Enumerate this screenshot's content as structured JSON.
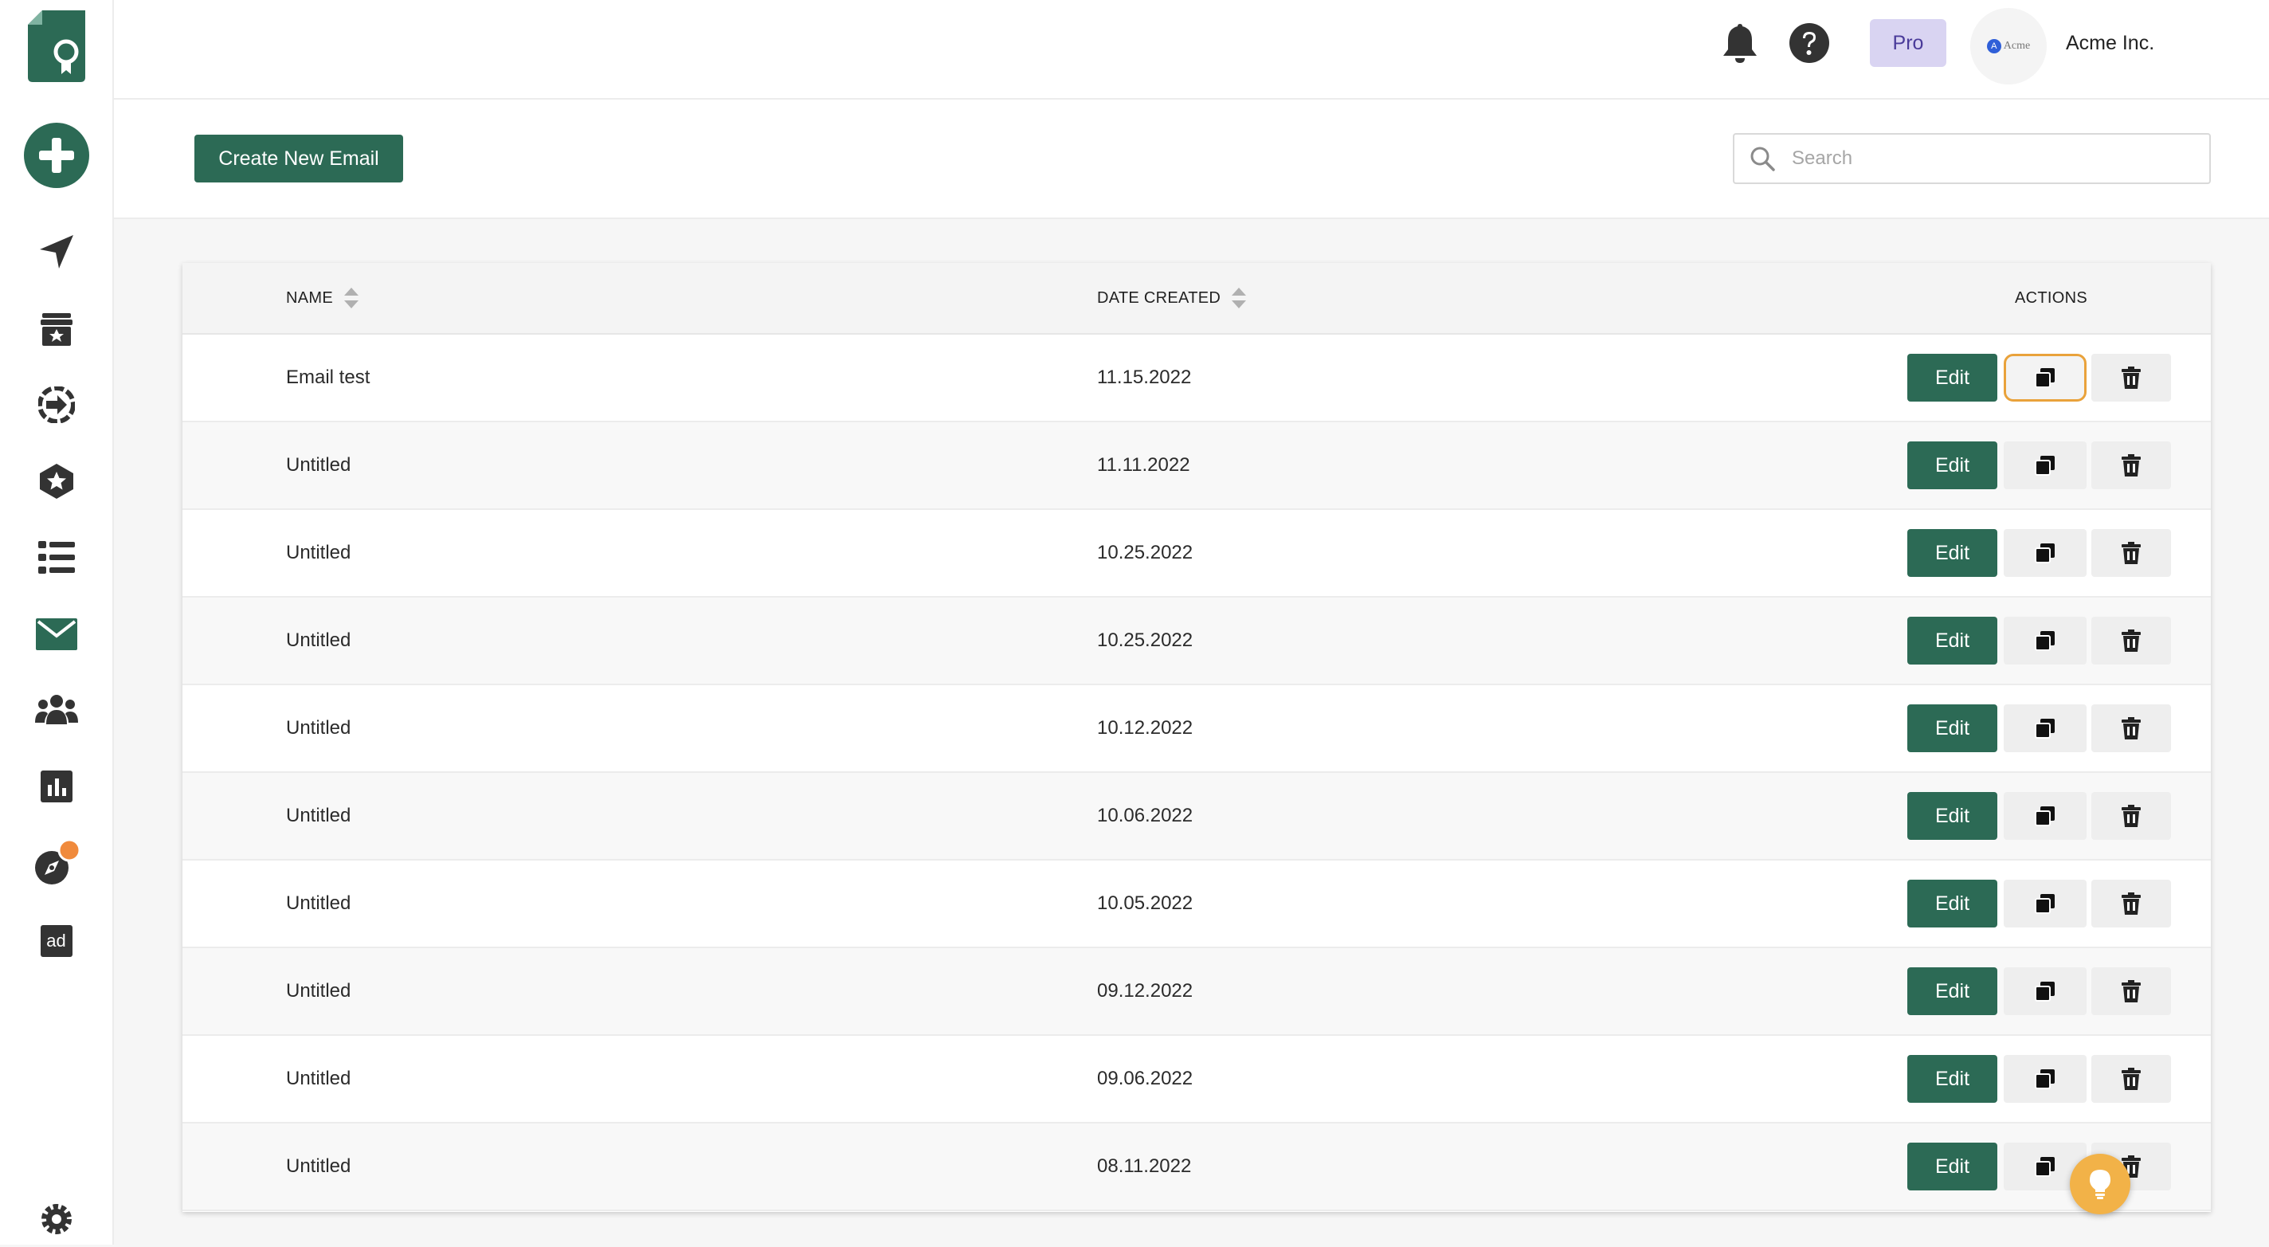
{
  "header": {
    "plan_badge": "Pro",
    "org_logo_text": "Acme",
    "org_logo_initial": "A",
    "org_name": "Acme Inc."
  },
  "sidebar": {
    "items": [
      {
        "name": "create",
        "icon": "plus-circle-icon"
      },
      {
        "name": "campaigns",
        "icon": "send-icon"
      },
      {
        "name": "rewards",
        "icon": "gift-box-icon"
      },
      {
        "name": "integrations",
        "icon": "sign-in-icon"
      },
      {
        "name": "badges",
        "icon": "star-badge-icon"
      },
      {
        "name": "lists",
        "icon": "list-icon"
      },
      {
        "name": "emails",
        "icon": "envelope-icon"
      },
      {
        "name": "contacts",
        "icon": "users-icon"
      },
      {
        "name": "reports",
        "icon": "bar-chart-icon"
      },
      {
        "name": "explore",
        "icon": "compass-icon",
        "has_notification": true
      },
      {
        "name": "ads",
        "icon": "ad-icon",
        "label": "ad"
      },
      {
        "name": "settings",
        "icon": "gear-icon"
      }
    ]
  },
  "toolbar": {
    "create_label": "Create New Email",
    "search_placeholder": "Search"
  },
  "table": {
    "columns": {
      "name": "NAME",
      "date": "DATE CREATED",
      "actions": "ACTIONS"
    },
    "edit_label": "Edit",
    "rows": [
      {
        "name": "Email test",
        "date": "11.15.2022"
      },
      {
        "name": "Untitled",
        "date": "11.11.2022"
      },
      {
        "name": "Untitled",
        "date": "10.25.2022"
      },
      {
        "name": "Untitled",
        "date": "10.25.2022"
      },
      {
        "name": "Untitled",
        "date": "10.12.2022"
      },
      {
        "name": "Untitled",
        "date": "10.06.2022"
      },
      {
        "name": "Untitled",
        "date": "10.05.2022"
      },
      {
        "name": "Untitled",
        "date": "09.12.2022"
      },
      {
        "name": "Untitled",
        "date": "09.06.2022"
      },
      {
        "name": "Untitled",
        "date": "08.11.2022"
      }
    ]
  },
  "colors": {
    "brand_green": "#2c6a55",
    "pro_badge_bg": "#d9d4f2",
    "focus_ring": "#e9a23b",
    "notification_dot": "#f08a3c",
    "help_fab": "#f2b248"
  }
}
